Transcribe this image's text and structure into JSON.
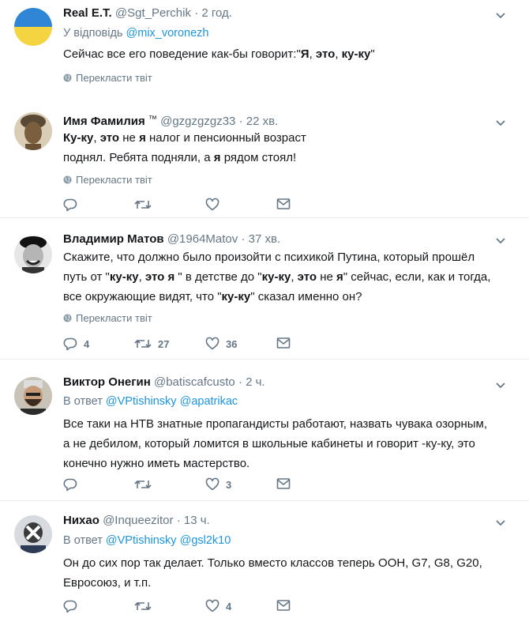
{
  "tweets": [
    {
      "name": "Real E.T.",
      "handle": "@Sgt_Perchik",
      "time": "2 год.",
      "reply_prefix": "У відповідь",
      "reply_to": [
        "@mix_voronezh"
      ],
      "body_lines": [
        [
          {
            "t": "Сейчас все его поведение как-бы говорит:\"",
            "b": false
          },
          {
            "t": "Я",
            "b": true
          },
          {
            "t": ", ",
            "b": false
          },
          {
            "t": "это",
            "b": true
          },
          {
            "t": ", ",
            "b": false
          },
          {
            "t": "ку-ку",
            "b": true
          },
          {
            "t": "\"",
            "b": false
          }
        ]
      ],
      "translate": "Перекласти твіт",
      "actions": null
    },
    {
      "name": "Имя Фамилия",
      "name_suffix": "™",
      "handle": "@gzgzgzgz33",
      "time": "22 хв.",
      "body_lines": [
        [
          {
            "t": "Ку-ку",
            "b": true
          },
          {
            "t": ", ",
            "b": false
          },
          {
            "t": "это",
            "b": true
          },
          {
            "t": " не ",
            "b": false
          },
          {
            "t": "я",
            "b": true
          },
          {
            "t": " налог и пенсионный возраст",
            "b": false
          }
        ],
        [
          {
            "t": "поднял. Ребята подняли, а ",
            "b": false
          },
          {
            "t": "я",
            "b": true
          },
          {
            "t": " рядом стоял!",
            "b": false
          }
        ]
      ],
      "translate": "Перекласти твіт",
      "actions": {
        "replies": "",
        "retweets": "",
        "likes": ""
      }
    },
    {
      "name": "Владимир Матов",
      "handle": "@1964Matov",
      "time": "37 хв.",
      "body_lines": [
        [
          {
            "t": "Скажите, что должно было произойти с психикой Путина, который прошёл",
            "b": false
          }
        ],
        [
          {
            "t": "путь от \"",
            "b": false
          },
          {
            "t": "ку-ку",
            "b": true
          },
          {
            "t": ", ",
            "b": false
          },
          {
            "t": "это я",
            "b": true
          },
          {
            "t": " \" в детстве до \"",
            "b": false
          },
          {
            "t": "ку-ку",
            "b": true
          },
          {
            "t": ", ",
            "b": false
          },
          {
            "t": "это",
            "b": true
          },
          {
            "t": " не ",
            "b": false
          },
          {
            "t": "я",
            "b": true
          },
          {
            "t": "\" сейчас, если, как и тогда,",
            "b": false
          }
        ],
        [
          {
            "t": "все окружающие видят, что \"",
            "b": false
          },
          {
            "t": "ку-ку",
            "b": true
          },
          {
            "t": "\" сказал именно он?",
            "b": false
          }
        ]
      ],
      "translate": "Перекласти твіт",
      "actions": {
        "replies": "4",
        "retweets": "27",
        "likes": "36"
      }
    },
    {
      "name": "Виктор Онегин",
      "handle": "@batiscafcusto",
      "time": "2 ч.",
      "reply_prefix": "В ответ",
      "reply_to": [
        "@VPtishinsky",
        "@apatrikac"
      ],
      "body_lines": [
        [
          {
            "t": "Все таки на НТВ знатные пропагандисты работают, назвать чувака озорным,",
            "b": false
          }
        ],
        [
          {
            "t": "а не дебилом, который ломится в школьные кабинеты и говорит -ку-ку, это",
            "b": false
          }
        ],
        [
          {
            "t": "конечно нужно иметь мастерство.",
            "b": false
          }
        ]
      ],
      "actions": {
        "replies": "",
        "retweets": "",
        "likes": "3"
      }
    },
    {
      "name": "Нихао",
      "handle": "@Inqueezitor",
      "time": "13 ч.",
      "reply_prefix": "В ответ",
      "reply_to": [
        "@VPtishinsky",
        "@gsl2k10"
      ],
      "body_lines": [
        [
          {
            "t": "Он до сих пор так делает. Только вместо классов теперь ООН, G7, G8, G20,",
            "b": false
          }
        ],
        [
          {
            "t": "Евросоюз, и т.п.",
            "b": false
          }
        ]
      ],
      "actions": {
        "replies": "",
        "retweets": "",
        "likes": "4"
      }
    }
  ]
}
